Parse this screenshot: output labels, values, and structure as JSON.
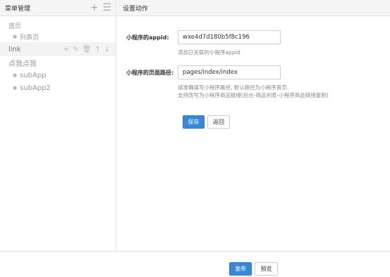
{
  "sidebar": {
    "title": "菜单管理",
    "add_icon": "plus-icon",
    "list_icon": "menu-icon",
    "items": [
      {
        "label": "首页",
        "level": 0
      },
      {
        "label": "列表页",
        "level": 1
      },
      {
        "label": "link",
        "level": 0,
        "selected": true
      },
      {
        "label": "点我点我",
        "level": 0
      },
      {
        "label": "subApp",
        "level": 1
      },
      {
        "label": "subApp2",
        "level": 1
      }
    ],
    "row_action_icons": [
      "plus-icon",
      "edit-icon",
      "trash-icon",
      "arrow-up-icon",
      "arrow-down-icon"
    ]
  },
  "main": {
    "title": "设置动作",
    "appid": {
      "label": "小程序的appid:",
      "value": "wxe4d7d180b5f8c196",
      "help": "添加已关联的小程序appid"
    },
    "path": {
      "label": "小程序的页面路径:",
      "value": "pages/index/index",
      "help_line1": "请准确填写小程序路径, 默认路径为小程序首页.",
      "help_line2": "支持改写为小程序商品链接(后台-商品列表-小程序商品链接复制)"
    },
    "save_label": "保存",
    "back_label": "返回"
  },
  "footer": {
    "publish_label": "发布",
    "preview_label": "预览"
  },
  "colors": {
    "primary": "#3a87d8",
    "header_bg": "#f5f5f5",
    "border": "#e2e2e2"
  }
}
